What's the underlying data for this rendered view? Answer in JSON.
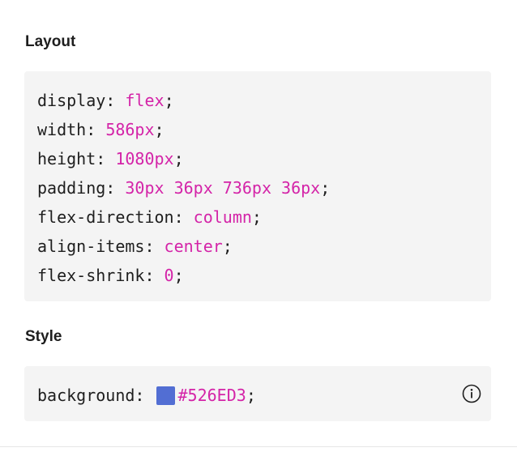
{
  "sections": {
    "layout": {
      "title": "Layout",
      "lines": [
        {
          "prop": "display",
          "value": "flex"
        },
        {
          "prop": "width",
          "value": "586px"
        },
        {
          "prop": "height",
          "value": "1080px"
        },
        {
          "prop": "padding",
          "value": "30px 36px 736px 36px"
        },
        {
          "prop": "flex-direction",
          "value": "column"
        },
        {
          "prop": "align-items",
          "value": "center"
        },
        {
          "prop": "flex-shrink",
          "value": "0"
        }
      ]
    },
    "style": {
      "title": "Style",
      "background": {
        "prop": "background",
        "value": "#526ED3",
        "swatch_color": "#526ED3"
      },
      "info_icon": "info-circle-icon"
    }
  },
  "syntax": {
    "colon": ":",
    "semicolon": ";"
  },
  "colors": {
    "value_text": "#d424a8",
    "panel_bg": "#f4f4f4",
    "text": "#1e1e1e"
  }
}
